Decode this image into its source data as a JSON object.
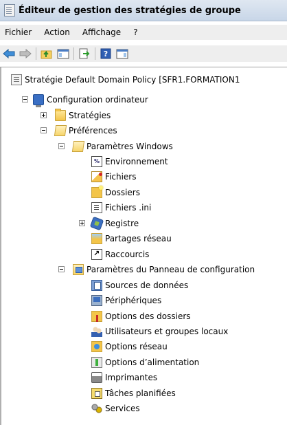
{
  "window": {
    "title": "Éditeur de gestion des stratégies de groupe"
  },
  "menu": [
    "Fichier",
    "Action",
    "Affichage",
    "?"
  ],
  "toolbar": {
    "buttons": [
      "back-arrow-icon",
      "forward-arrow-icon",
      "up-folder-icon",
      "show-hide-tree-icon",
      "export-list-icon",
      "help-icon",
      "console-view-icon"
    ]
  },
  "tree": {
    "root": "Stratégie Default Domain Policy [SFR1.FORMATION1",
    "computer_config": "Configuration ordinateur",
    "strategies": "Stratégies",
    "preferences": "Préférences",
    "windows_settings": "Paramètres Windows",
    "windows_items": [
      "Environnement",
      "Fichiers",
      "Dossiers",
      "Fichiers .ini",
      "Registre",
      "Partages réseau",
      "Raccourcis"
    ],
    "control_panel": "Paramètres du Panneau de configuration",
    "control_items": [
      "Sources de données",
      "Périphériques",
      "Options des dossiers",
      "Utilisateurs et groupes locaux",
      "Options réseau",
      "Options d’alimentation",
      "Imprimantes",
      "Tâches planifiées",
      "Services"
    ]
  },
  "icons": {
    "root": "policy-icon",
    "computer": "computer-icon",
    "folder": "folder-icon",
    "windows_items": [
      "environment-icon",
      "files-icon",
      "folders-icon",
      "ini-files-icon",
      "registry-icon",
      "network-shares-icon",
      "shortcuts-icon"
    ],
    "control_items": [
      "data-sources-icon",
      "devices-icon",
      "folder-options-icon",
      "local-users-groups-icon",
      "network-options-icon",
      "power-options-icon",
      "printers-icon",
      "scheduled-tasks-icon",
      "services-icon"
    ]
  }
}
